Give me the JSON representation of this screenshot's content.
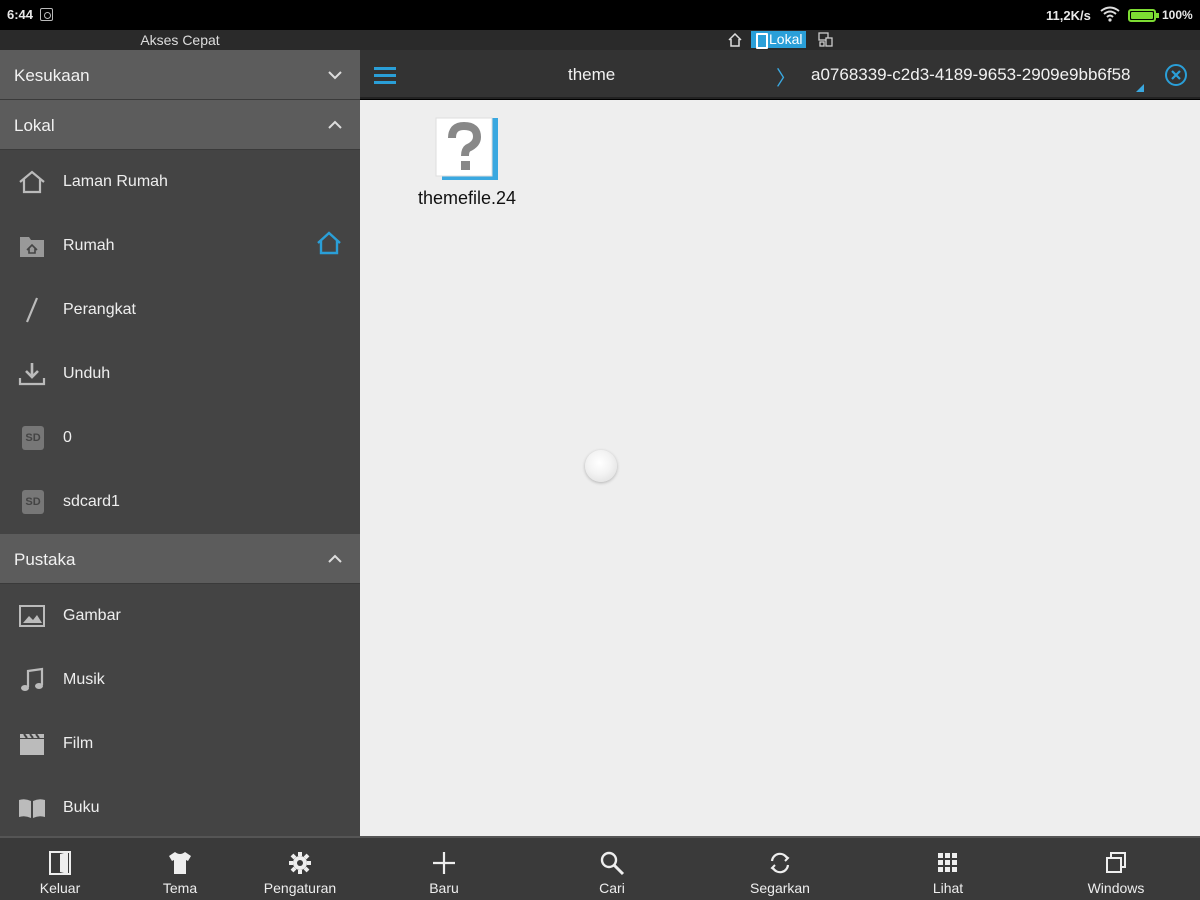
{
  "status_bar": {
    "time": "6:44",
    "net_speed": "11,2K/s",
    "battery": "100%",
    "battery_color": "#7ddc33"
  },
  "drawer": {
    "title": "Akses Cepat",
    "favorites": {
      "label": "Kesukaan",
      "state": "collapsed"
    },
    "local": {
      "label": "Lokal",
      "state": "expanded",
      "items": [
        {
          "label": "Laman Rumah",
          "icon": "home-outline-icon"
        },
        {
          "label": "Rumah",
          "icon": "folder-home-icon"
        },
        {
          "label": "Perangkat",
          "icon": "slash-icon"
        },
        {
          "label": "Unduh",
          "icon": "download-icon"
        },
        {
          "label": "0",
          "icon": "sd-card-icon",
          "badge_text": "SD"
        },
        {
          "label": "sdcard1",
          "icon": "sd-card-icon",
          "badge_text": "SD"
        }
      ]
    },
    "library": {
      "label": "Pustaka",
      "state": "expanded",
      "items": [
        {
          "label": "Gambar",
          "icon": "image-icon"
        },
        {
          "label": "Musik",
          "icon": "music-note-icon"
        },
        {
          "label": "Film",
          "icon": "clapperboard-icon"
        },
        {
          "label": "Buku",
          "icon": "book-icon"
        }
      ]
    },
    "bottom": [
      {
        "label": "Keluar",
        "icon": "exit-icon"
      },
      {
        "label": "Tema",
        "icon": "tshirt-icon"
      },
      {
        "label": "Pengaturan",
        "icon": "gear-icon"
      }
    ]
  },
  "tabs": {
    "active": "Lokal"
  },
  "toolbar": {
    "path": [
      "theme",
      "a0768339-c2d3-4189-9653-2909e9bb6f58"
    ],
    "separator": "〉",
    "accent": "#2a9fd8"
  },
  "files": [
    {
      "name": "themefile.24",
      "icon": "unknown-file-icon"
    }
  ],
  "bottom_actions": [
    {
      "label": "Baru",
      "icon": "plus-icon"
    },
    {
      "label": "Cari",
      "icon": "search-icon"
    },
    {
      "label": "Segarkan",
      "icon": "refresh-icon"
    },
    {
      "label": "Lihat",
      "icon": "grid-view-icon"
    },
    {
      "label": "Windows",
      "icon": "windows-stack-icon"
    }
  ]
}
